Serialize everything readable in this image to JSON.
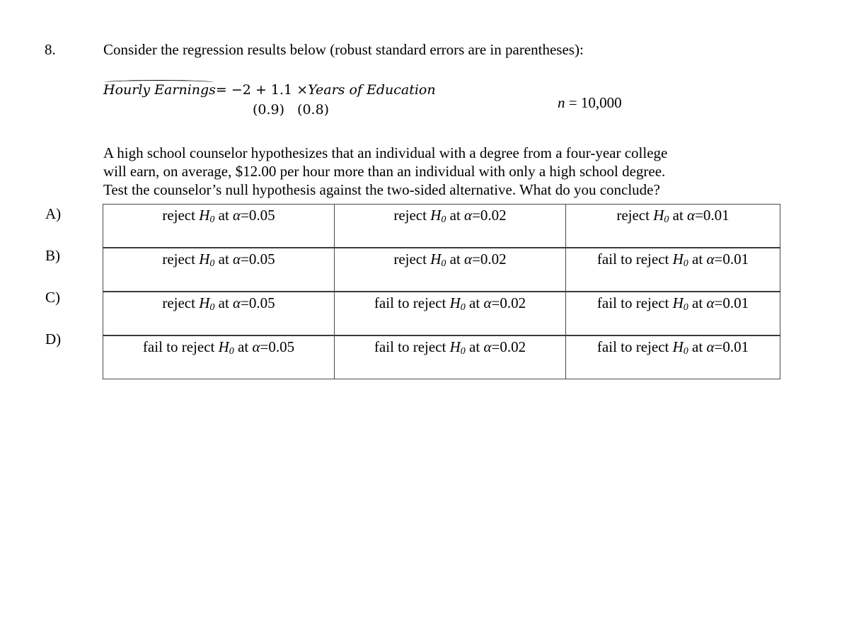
{
  "question": {
    "number": "8.",
    "prompt": "Consider the regression results below (robust standard errors are in parentheses):",
    "equation": {
      "lhs": "Hourly Earnings",
      "equals": "=",
      "intercept": "−2",
      "plus": "+",
      "slope": "1.1",
      "times": "×",
      "regressor": "Years of Education",
      "se_intercept": "(0.9)",
      "se_slope": "(0.8)"
    },
    "sample_size": {
      "symbol": "n",
      "equals": "=",
      "value": "10,000"
    },
    "paragraph": [
      "A high school counselor hypothesizes that an individual with a degree from a four-year college",
      "will earn, on average, $12.00 per hour more than an individual with only a high school degree.",
      "Test the counselor’s null hypothesis against the two-sided alternative.  What do you conclude?"
    ]
  },
  "options": [
    {
      "label": "A)",
      "cells": [
        {
          "verb": "reject",
          "alpha": "0.05"
        },
        {
          "verb": "reject",
          "alpha": "0.02"
        },
        {
          "verb": "reject",
          "alpha": "0.01"
        }
      ]
    },
    {
      "label": "B)",
      "cells": [
        {
          "verb": "reject",
          "alpha": "0.05"
        },
        {
          "verb": "reject",
          "alpha": "0.02"
        },
        {
          "verb": "fail to reject",
          "alpha": "0.01"
        }
      ]
    },
    {
      "label": "C)",
      "cells": [
        {
          "verb": "reject",
          "alpha": "0.05"
        },
        {
          "verb": "fail to reject",
          "alpha": "0.02"
        },
        {
          "verb": "fail to reject",
          "alpha": "0.01"
        }
      ]
    },
    {
      "label": "D)",
      "cells": [
        {
          "verb": "fail to reject",
          "alpha": "0.05"
        },
        {
          "verb": "fail to reject",
          "alpha": "0.02"
        },
        {
          "verb": "fail to reject",
          "alpha": "0.01"
        }
      ]
    }
  ],
  "notation": {
    "hypothesis_letter": "H",
    "hypothesis_sub": "0",
    "at": "at",
    "alpha_symbol": "α",
    "equals": "="
  }
}
